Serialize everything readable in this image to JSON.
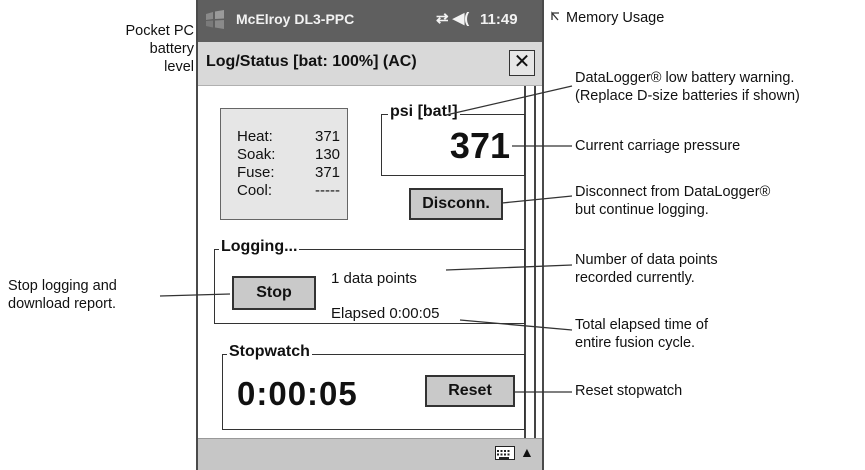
{
  "taskbar": {
    "start_icon": "windows-flag-icon",
    "app_title": "McElroy DL3-PPC",
    "status_icons": "⇄ ◀(",
    "time": "11:49"
  },
  "window": {
    "caption": "Log/Status  [bat: 100%] (AC)",
    "close_label": "✕"
  },
  "stages": [
    {
      "label": "Heat:",
      "value": "371"
    },
    {
      "label": "Soak:",
      "value": "130"
    },
    {
      "label": "Fuse:",
      "value": "371"
    },
    {
      "label": "Cool:",
      "value": "-----"
    }
  ],
  "pressure": {
    "legend": "psi [bat!]",
    "value": "371"
  },
  "disconnect_label": "Disconn.",
  "logging": {
    "legend": "Logging...",
    "stop_label": "Stop",
    "data_points": "1 data points",
    "elapsed": "Elapsed 0:00:05"
  },
  "stopwatch": {
    "legend": "Stopwatch",
    "value": "0:00:05",
    "reset_label": "Reset"
  },
  "bottom_bar": {
    "keyboard_icon": "keyboard-icon",
    "arrow": "▲"
  },
  "annotations": {
    "battery_level": "Pocket PC\nbattery\nlevel",
    "memory_usage": "Memory Usage",
    "low_battery": "DataLogger® low battery warning.\n(Replace D-size batteries if shown)",
    "carriage_pressure": "Current carriage pressure",
    "disconnect": "Disconnect from DataLogger®\nbut continue logging.",
    "data_points": "Number of data points\nrecorded currently.",
    "stop": "Stop logging and\ndownload report.",
    "elapsed": "Total elapsed time of\nentire fusion cycle.",
    "reset": "Reset stopwatch"
  }
}
